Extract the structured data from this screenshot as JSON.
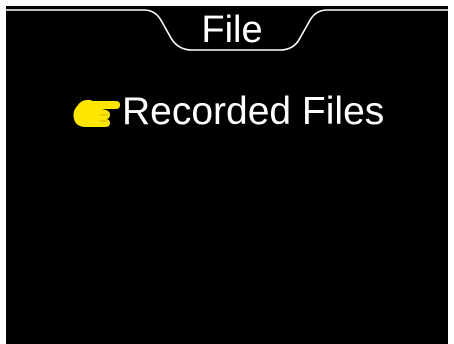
{
  "header": {
    "tab_label": "File"
  },
  "menu": {
    "items": [
      {
        "label": "Recorded Files",
        "selected": true,
        "indicator_icon": "pointing-hand-icon"
      }
    ]
  },
  "colors": {
    "background": "#000000",
    "text": "#ffffff",
    "selection_pointer": "#ffe600"
  }
}
